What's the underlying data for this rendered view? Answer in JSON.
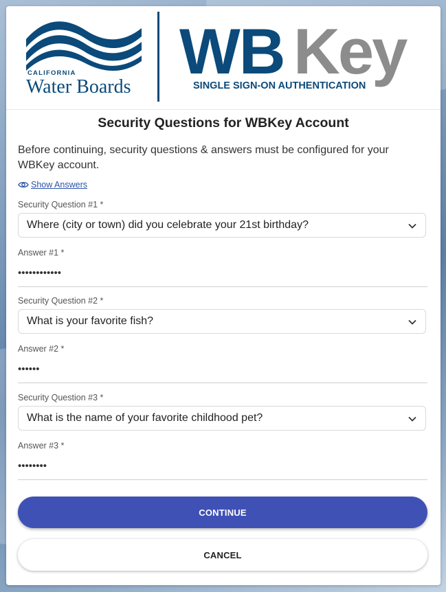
{
  "brand": {
    "wb_top": "CALIFORNIA",
    "wb_name": "Water Boards",
    "wbkey_wb": "WB",
    "wbkey_key": "Key",
    "wbkey_tagline": "SINGLE SIGN-ON AUTHENTICATION",
    "colors": {
      "navy": "#0b4a7a",
      "gray": "#8c8c8c",
      "primary": "#3f51b5",
      "link": "#2a53a8"
    }
  },
  "page": {
    "title": "Security Questions for WBKey Account",
    "intro": "Before continuing, security questions & answers must be configured for your WBKey account.",
    "show_answers": "Show Answers",
    "show_answers_icon": "eye-icon"
  },
  "questions": [
    {
      "label": "Security Question #1 *",
      "selected": "Where (city or town) did you celebrate your 21st birthday?",
      "answer_label": "Answer #1 *",
      "answer_masked": "••••••••••••"
    },
    {
      "label": "Security Question #2 *",
      "selected": "What is your favorite fish?",
      "answer_label": "Answer #2 *",
      "answer_masked": "••••••"
    },
    {
      "label": "Security Question #3 *",
      "selected": "What is the name of your favorite childhood pet?",
      "answer_label": "Answer #3 *",
      "answer_masked": "••••••••"
    }
  ],
  "actions": {
    "continue": "CONTINUE",
    "cancel": "CANCEL"
  }
}
